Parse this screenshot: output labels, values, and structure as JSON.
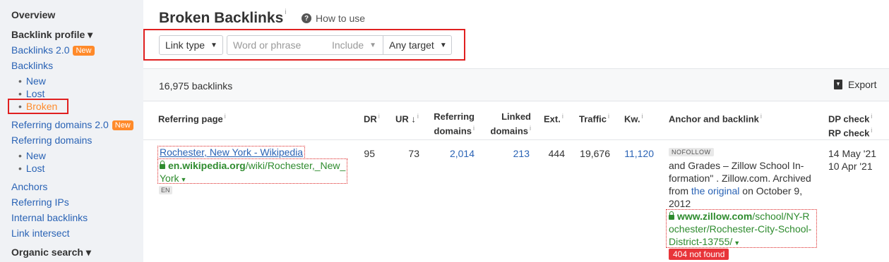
{
  "sidebar": {
    "overview": "Overview",
    "backlink_profile": "Backlink profile ▾",
    "backlinks2": "Backlinks 2.0",
    "new_badge": "New",
    "backlinks": "Backlinks",
    "backlinks_new": "New",
    "backlinks_lost": "Lost",
    "backlinks_broken": "Broken",
    "refdomains2": "Referring domains 2.0",
    "refdomains": "Referring domains",
    "refdomains_new": "New",
    "refdomains_lost": "Lost",
    "anchors": "Anchors",
    "referring_ips": "Referring IPs",
    "internal_backlinks": "Internal backlinks",
    "link_intersect": "Link intersect",
    "organic_search": "Organic search ▾"
  },
  "header": {
    "title": "Broken Backlinks",
    "title_info": "i",
    "how_to_use": "How to use"
  },
  "filters": {
    "link_type": "Link type",
    "search_placeholder": "Word or phrase",
    "include": "Include",
    "any_target": "Any target"
  },
  "summary": {
    "count": "16,975 backlinks",
    "export": "Export"
  },
  "table": {
    "headers": {
      "referring_page": "Referring page",
      "dr": "DR",
      "ur": "UR",
      "ur_sort": "↓",
      "referring_domains_1": "Referring",
      "referring_domains_2": "domains",
      "linked_domains_1": "Linked",
      "linked_domains_2": "domains",
      "ext": "Ext.",
      "traffic": "Traffic",
      "kw": "Kw.",
      "anchor_backlink": "Anchor and backlink",
      "dp_check": "DP check",
      "rp_check": "RP check"
    },
    "row": {
      "page_title": "Rochester, New York - Wikipedia",
      "url_domain": "en.wikipedia.org",
      "url_path_1": "/wiki/Rochester,_New_",
      "url_path_2": "York",
      "lang": "EN",
      "dr": "95",
      "ur": "73",
      "referring_domains": "2,014",
      "linked_domains": "213",
      "ext": "444",
      "traffic": "19,676",
      "kw": "11,120",
      "nofollow": "NOFOLLOW",
      "anchor_line_1": "and Grades – Zillow School In-",
      "anchor_line_2": "formation\" . Zillow.com. Archived",
      "anchor_line_3_a": "from ",
      "anchor_line_3_link": "the original",
      "anchor_line_3_b": " on October 9,",
      "anchor_line_4": "2012",
      "backlink_domain": "www.zillow.com",
      "backlink_path_1": "/school/NY-R",
      "backlink_path_2": "ochester/Rochester-City-School-",
      "backlink_path_3": "District-13755/",
      "status": "404 not found",
      "dp_date": "14 May '21",
      "rp_date": "10 Apr '21"
    }
  },
  "colors": {
    "link": "#2a63b5",
    "url_green": "#2e8b2e",
    "highlight_red": "#e02020",
    "badge_orange": "#ff8a2a",
    "error_red": "#e8353a"
  }
}
